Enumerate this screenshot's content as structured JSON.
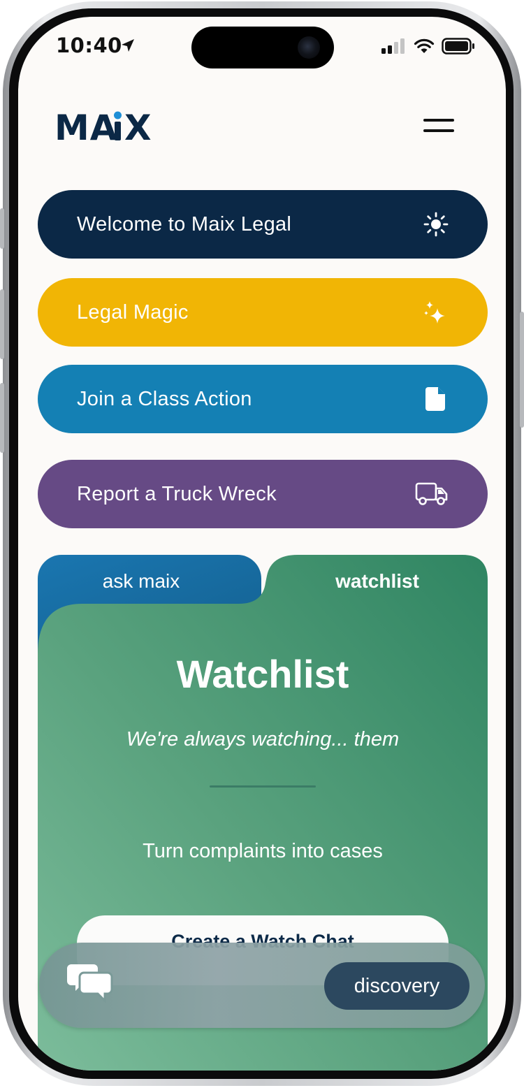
{
  "status_bar": {
    "time": "10:40"
  },
  "brand": {
    "logo_text": "MAiX"
  },
  "actions": [
    {
      "label": "Welcome to Maix Legal",
      "icon": "sun-icon",
      "color": "#0b2846"
    },
    {
      "label": "Legal Magic",
      "icon": "sparkles-icon",
      "color": "#f1b505"
    },
    {
      "label": "Join a Class Action",
      "icon": "document-icon",
      "color": "#1480b4"
    },
    {
      "label": "Report a Truck Wreck",
      "icon": "truck-icon",
      "color": "#664a85"
    }
  ],
  "tabs": [
    {
      "label": "ask maix",
      "active": false,
      "color": "#1670a8"
    },
    {
      "label": "watchlist",
      "active": true,
      "color": "#3a8a66"
    }
  ],
  "watchlist": {
    "title": "Watchlist",
    "subtitle": "We're always watching... them",
    "description": "Turn complaints into cases",
    "cta_label": "Create a Watch Chat"
  },
  "bottom_bar": {
    "chat_icon": "chat-bubbles-icon",
    "discovery_label": "discovery"
  }
}
